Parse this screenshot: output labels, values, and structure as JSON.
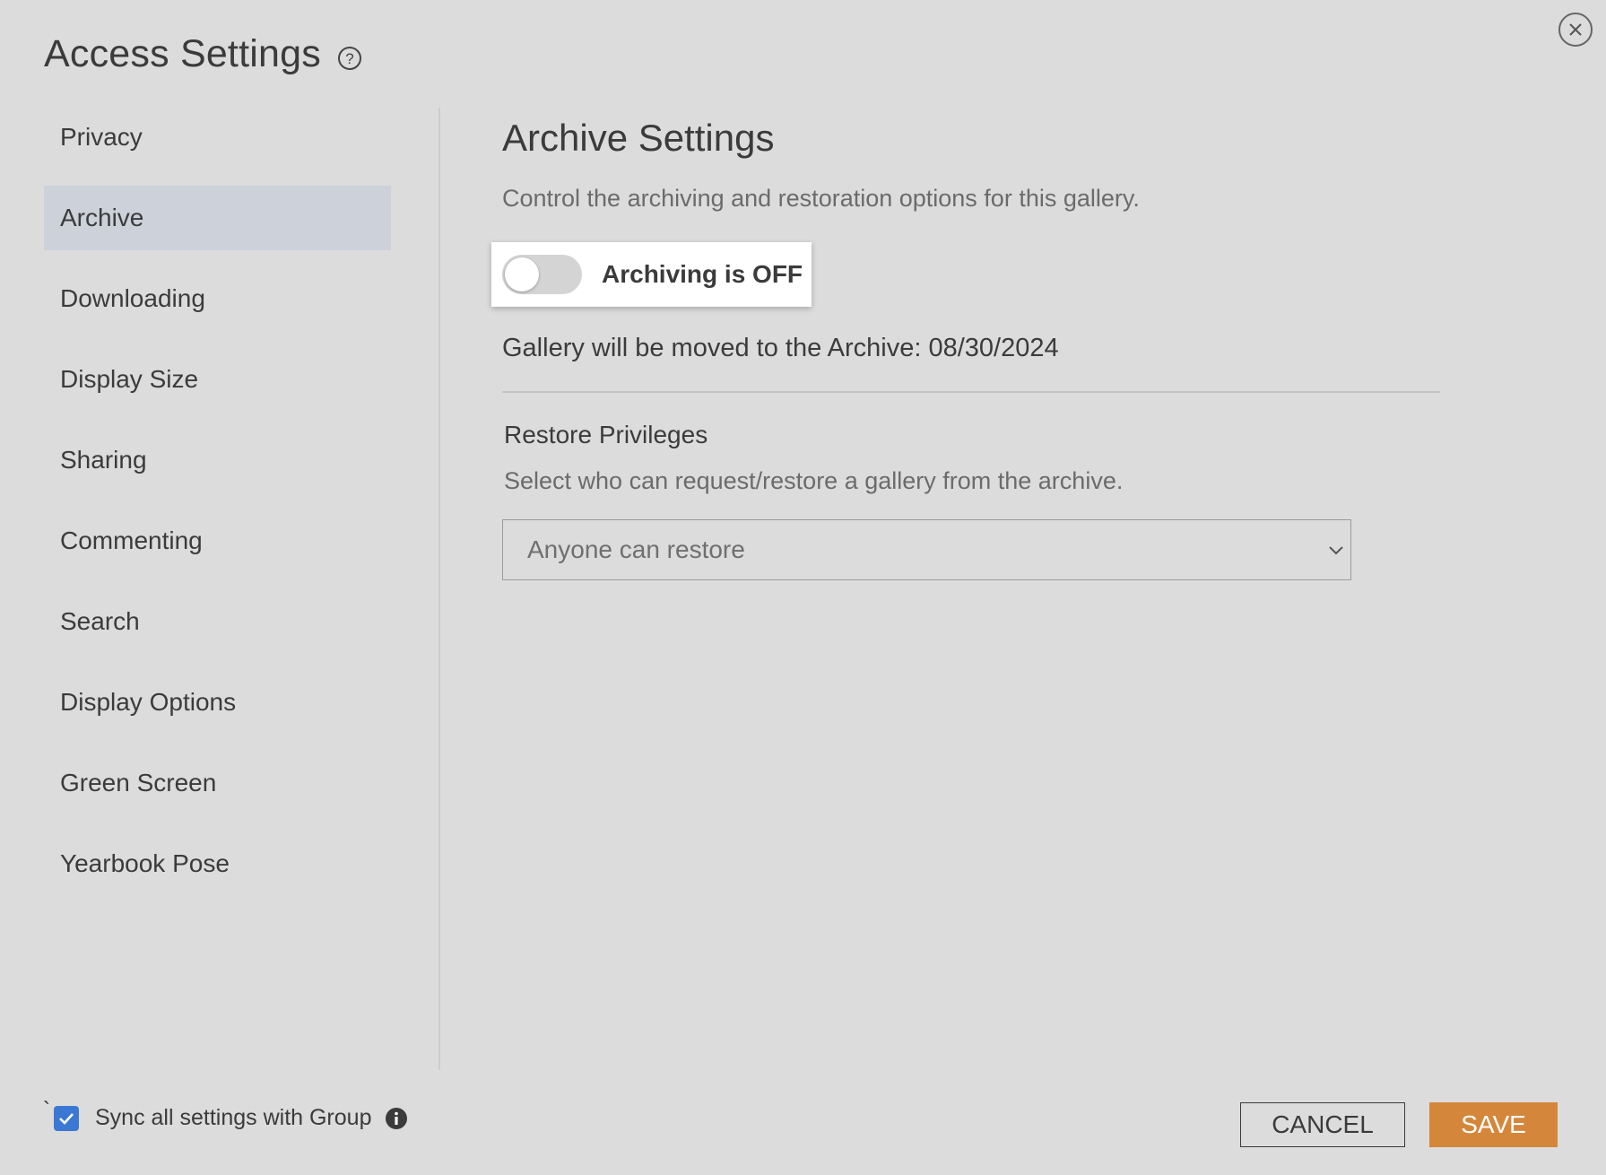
{
  "header": {
    "title": "Access Settings",
    "help_icon": "question-circle-icon",
    "close_icon": "close-circle-icon"
  },
  "sidebar": {
    "items": [
      {
        "label": "Privacy",
        "active": false
      },
      {
        "label": "Archive",
        "active": true
      },
      {
        "label": "Downloading",
        "active": false
      },
      {
        "label": "Display Size",
        "active": false
      },
      {
        "label": "Sharing",
        "active": false
      },
      {
        "label": "Commenting",
        "active": false
      },
      {
        "label": "Search",
        "active": false
      },
      {
        "label": "Display Options",
        "active": false
      },
      {
        "label": "Green Screen",
        "active": false
      },
      {
        "label": "Yearbook Pose",
        "active": false
      }
    ]
  },
  "main": {
    "title": "Archive Settings",
    "description": "Control the archiving and restoration options for this gallery.",
    "toggle": {
      "label": "Archiving is OFF",
      "on": false
    },
    "archive_date_text": "Gallery will be moved to the Archive: 08/30/2024",
    "restore": {
      "title": "Restore Privileges",
      "description": "Select who can request/restore a gallery from the archive.",
      "selected": "Anyone can restore"
    }
  },
  "footer": {
    "tick_char": "`",
    "sync_label": "Sync all settings with Group",
    "sync_checked": true,
    "info_icon": "info-circle-icon",
    "cancel_label": "CANCEL",
    "save_label": "SAVE"
  },
  "colors": {
    "background": "#dcdcdc",
    "active_nav": "#cdd1d9",
    "save_button": "#d4873a",
    "checkbox": "#3b78d4"
  }
}
